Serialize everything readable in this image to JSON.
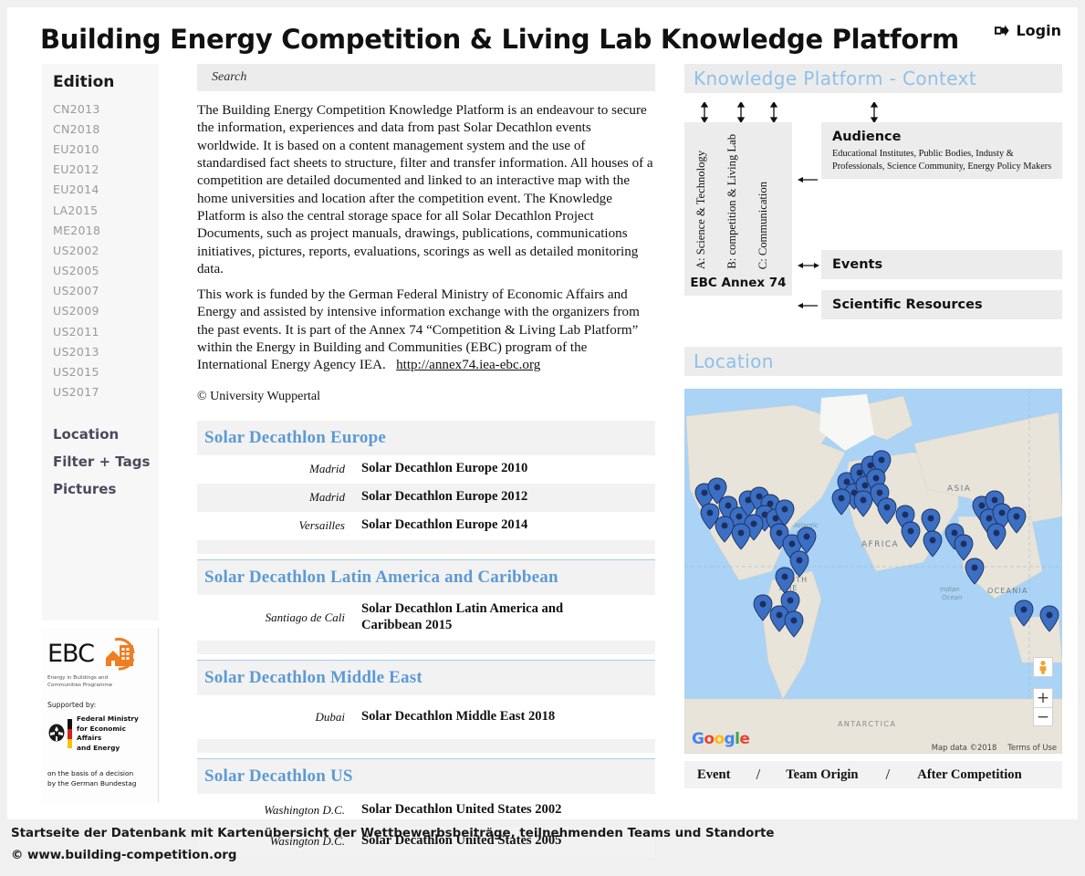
{
  "header": {
    "title": "Building Energy Competition & Living Lab Knowledge Platform",
    "login_label": "Login",
    "login_icon": "sign-in-icon"
  },
  "sidebar": {
    "heading": "Edition",
    "editions": [
      "CN2013",
      "CN2018",
      "EU2010",
      "EU2012",
      "EU2014",
      "LA2015",
      "ME2018",
      "US2002",
      "US2005",
      "US2007",
      "US2009",
      "US2011",
      "US2013",
      "US2015",
      "US2017"
    ],
    "links": [
      "Location",
      "Filter + Tags",
      "Pictures"
    ],
    "logo": {
      "ebc_word": "EBC",
      "ebc_subtitle": "Energy in Buildings and\nCommunities Programme",
      "supported_by": "Supported by:",
      "ministry": "Federal Ministry\nfor Economic Affairs\nand Energy",
      "bundestag": "on the basis of a decision\nby the German Bundestag"
    }
  },
  "search": {
    "placeholder": "Search"
  },
  "intro": {
    "paragraph1": "The Building Energy Competition Knowledge Platform is an endeavour to secure the information, experiences and data from past Solar Decathlon events worldwide. It is based on a content management system and the use of standardised fact sheets to structure, filter and transfer information. All houses of a competition are detailed documented and linked to an interactive map with the home universities and location after the competition event. The Knowledge Platform is also the central storage space for all Solar Decathlon Project Documents, such as project manuals, drawings, publications, communications initiatives, pictures, reports, evaluations, scorings as well as detailed monitoring data.",
    "paragraph2": "This work is funded by the German Federal Ministry of Economic Affairs and Energy and assisted by intensive information exchange with the organizers from the past events. It is part of the Annex 74 “Competition & Living Lab Platform” within the Energy in Building and Communities (EBC) program of the International Energy Agency IEA.",
    "link": "http://annex74.iea-ebc.org",
    "copyright": "© University Wuppertal"
  },
  "tables": [
    {
      "title": "Solar Decathlon Europe",
      "rows": [
        {
          "city": "Madrid",
          "name": "Solar Decathlon Europe 2010"
        },
        {
          "city": "Madrid",
          "name": "Solar Decathlon Europe 2012"
        },
        {
          "city": "Versailles",
          "name": "Solar Decathlon Europe 2014"
        }
      ]
    },
    {
      "title": "Solar Decathlon Latin America and Caribbean",
      "rows": [
        {
          "city": "Santiago de Cali",
          "name": "Solar Decathlon Latin America and Caribbean 2015"
        }
      ]
    },
    {
      "title": "Solar Decathlon Middle East",
      "rows": [
        {
          "city": "Dubai",
          "name": "Solar Decathlon Middle East 2018"
        }
      ]
    },
    {
      "title": "Solar Decathlon US",
      "rows": [
        {
          "city": "Washington D.C.",
          "name": "Solar Decathlon United States 2002"
        },
        {
          "city": "Wasington D.C.",
          "name": "Solar Decathlon United States 2005"
        }
      ]
    }
  ],
  "context": {
    "panel_title": "Knowledge Platform - Context",
    "annex_label": "EBC Annex 74",
    "vertical_labels": [
      "A: Science & Technology",
      "B: competition & Living Lab",
      "C: Communication"
    ],
    "audience_title": "Audience",
    "audience_desc": "Educational Institutes, Public Bodies, Industy & Professionals, Science Community, Energy Policy Makers",
    "events_title": "Events",
    "scientific_title": "Scientific Resources"
  },
  "location": {
    "panel_title": "Location",
    "map_labels": [
      "ASIA",
      "AFRICA",
      "Atlantic Ocean",
      "SOUTH AME...",
      "Indian Ocean",
      "OCEANIA",
      "ANTARCTICA"
    ],
    "google_logo": "Google",
    "map_data": "Map data ©2018",
    "terms": "Terms of Use",
    "zoom_in": "+",
    "zoom_out": "−",
    "legend": {
      "event": "Event",
      "sep1": "/",
      "team_origin": "Team Origin",
      "sep2": "/",
      "after": "After Competition"
    }
  },
  "footer": {
    "caption": "Startseite der Datenbank mit Kartenübersicht der Wettbewerbsbeiträge, teilnehmenden Teams und Standorte",
    "source": "© www.building-competition.org"
  },
  "colors": {
    "accent_blue": "#5c9ad4",
    "panel_title_blue": "#8fc0e8",
    "marker_blue": "#4a7fd4",
    "ebc_orange": "#ef7d22"
  }
}
